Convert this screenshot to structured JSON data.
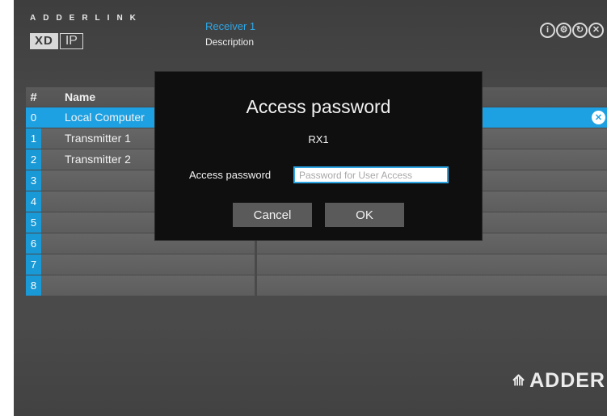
{
  "header": {
    "brand_line1": "ADDERLINK",
    "brand_xd": "XD",
    "brand_ip": "IP",
    "receiver_name": "Receiver 1",
    "receiver_description": "Description"
  },
  "top_icons": [
    {
      "name": "info-icon",
      "glyph": "i"
    },
    {
      "name": "settings-icon",
      "glyph": "⚙"
    },
    {
      "name": "refresh-icon",
      "glyph": "↻"
    },
    {
      "name": "close-icon",
      "glyph": "✕"
    }
  ],
  "table": {
    "header_num": "#",
    "header_name": "Name",
    "rows": [
      {
        "num": "0",
        "name": "Local Computer"
      },
      {
        "num": "1",
        "name": "Transmitter 1"
      },
      {
        "num": "2",
        "name": "Transmitter 2"
      },
      {
        "num": "3",
        "name": ""
      },
      {
        "num": "4",
        "name": ""
      },
      {
        "num": "5",
        "name": ""
      },
      {
        "num": "6",
        "name": ""
      },
      {
        "num": "7",
        "name": ""
      },
      {
        "num": "8",
        "name": ""
      }
    ],
    "active_row_close": "✕"
  },
  "modal": {
    "title": "Access password",
    "subtitle": "RX1",
    "field_label": "Access password",
    "field_placeholder": "Password for User Access",
    "field_value": "",
    "cancel_label": "Cancel",
    "ok_label": "OK"
  },
  "footer": {
    "logo_text": "ADDER",
    "logo_mark": "⟰"
  },
  "colors": {
    "accent": "#1da1e2",
    "background": "#474747",
    "modal_bg": "#0f0f0f",
    "button_bg": "#5a5a5a"
  }
}
